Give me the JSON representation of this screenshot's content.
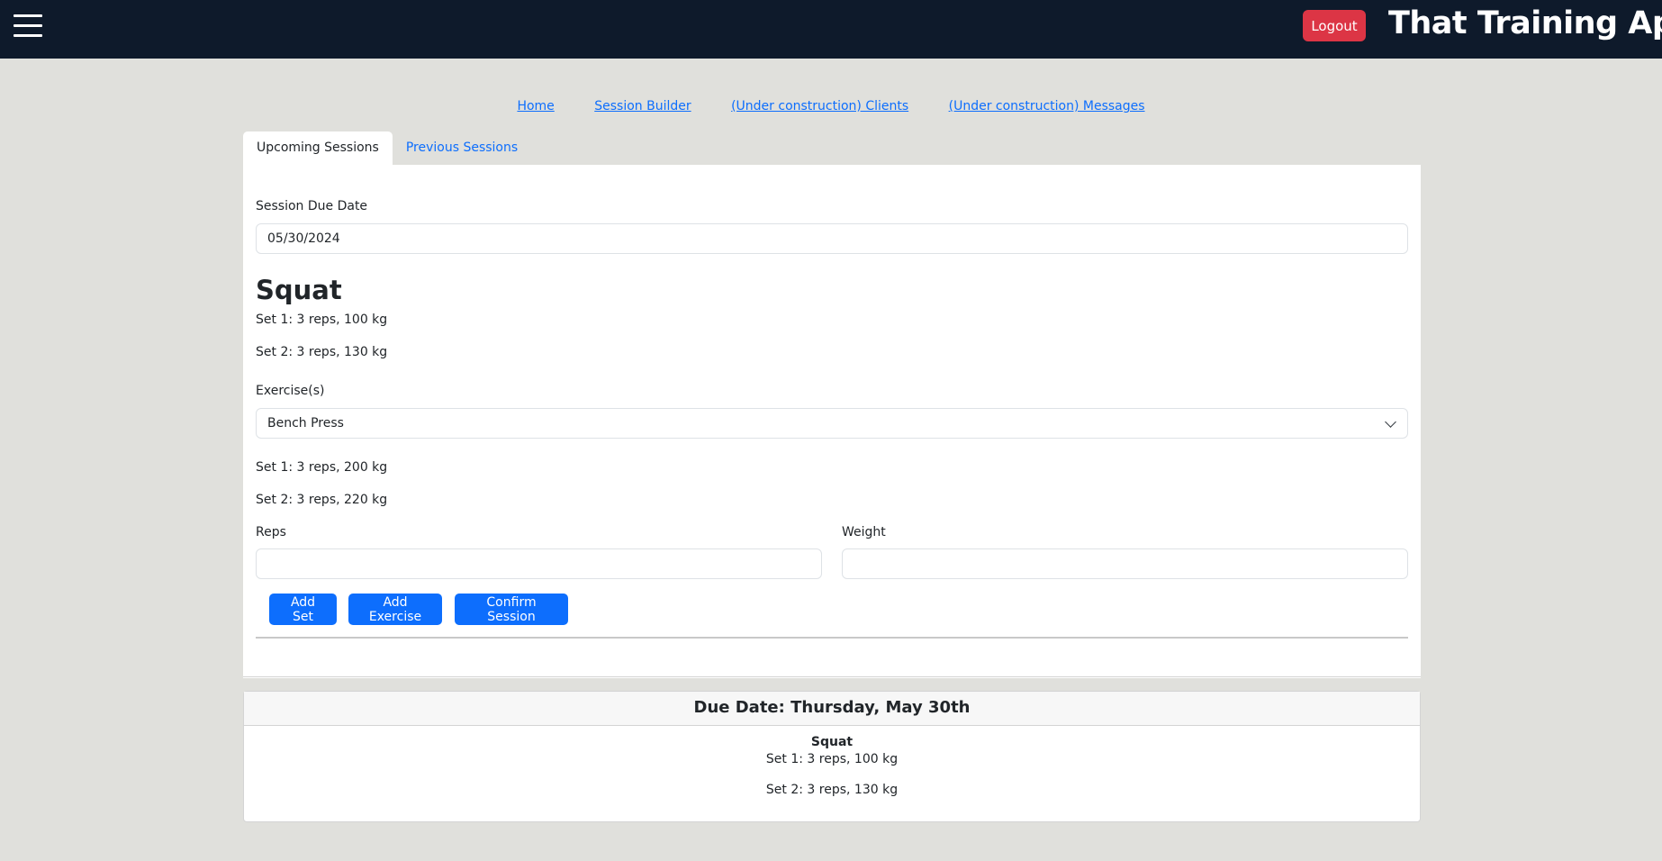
{
  "header": {
    "app_title": "That Training App",
    "logout_label": "Logout",
    "bg_color": "#0e1a2b",
    "logout_color": "#dc3545"
  },
  "nav": {
    "links": [
      "Home",
      "Session Builder",
      "(Under construction) Clients",
      "(Under construction) Messages"
    ]
  },
  "tabs": [
    {
      "label": "Upcoming Sessions",
      "active": true
    },
    {
      "label": "Previous Sessions",
      "active": false
    }
  ],
  "form": {
    "due_date_label": "Session Due Date",
    "due_date_value": "05/30/2024",
    "current_exercise": {
      "name": "Squat",
      "sets": [
        "Set 1: 3 reps, 100 kg",
        "Set 2: 3 reps, 130 kg"
      ]
    },
    "exercise_label": "Exercise(s)",
    "exercise_selected": "Bench Press",
    "selected_sets": [
      "Set 1: 3 reps, 200 kg",
      "Set 2: 3 reps, 220 kg"
    ],
    "reps_label": "Reps",
    "reps_value": "",
    "weight_label": "Weight",
    "weight_value": "",
    "buttons": {
      "add_set": "Add Set",
      "add_exercise": "Add Exercise",
      "confirm_session": "Confirm Session"
    }
  },
  "summary": {
    "title": "Due Date: Thursday, May 30th",
    "exercise_name": "Squat",
    "sets": [
      "Set 1: 3 reps, 100 kg",
      "Set 2: 3 reps, 130 kg"
    ]
  },
  "accent_color": "#0d6efd"
}
